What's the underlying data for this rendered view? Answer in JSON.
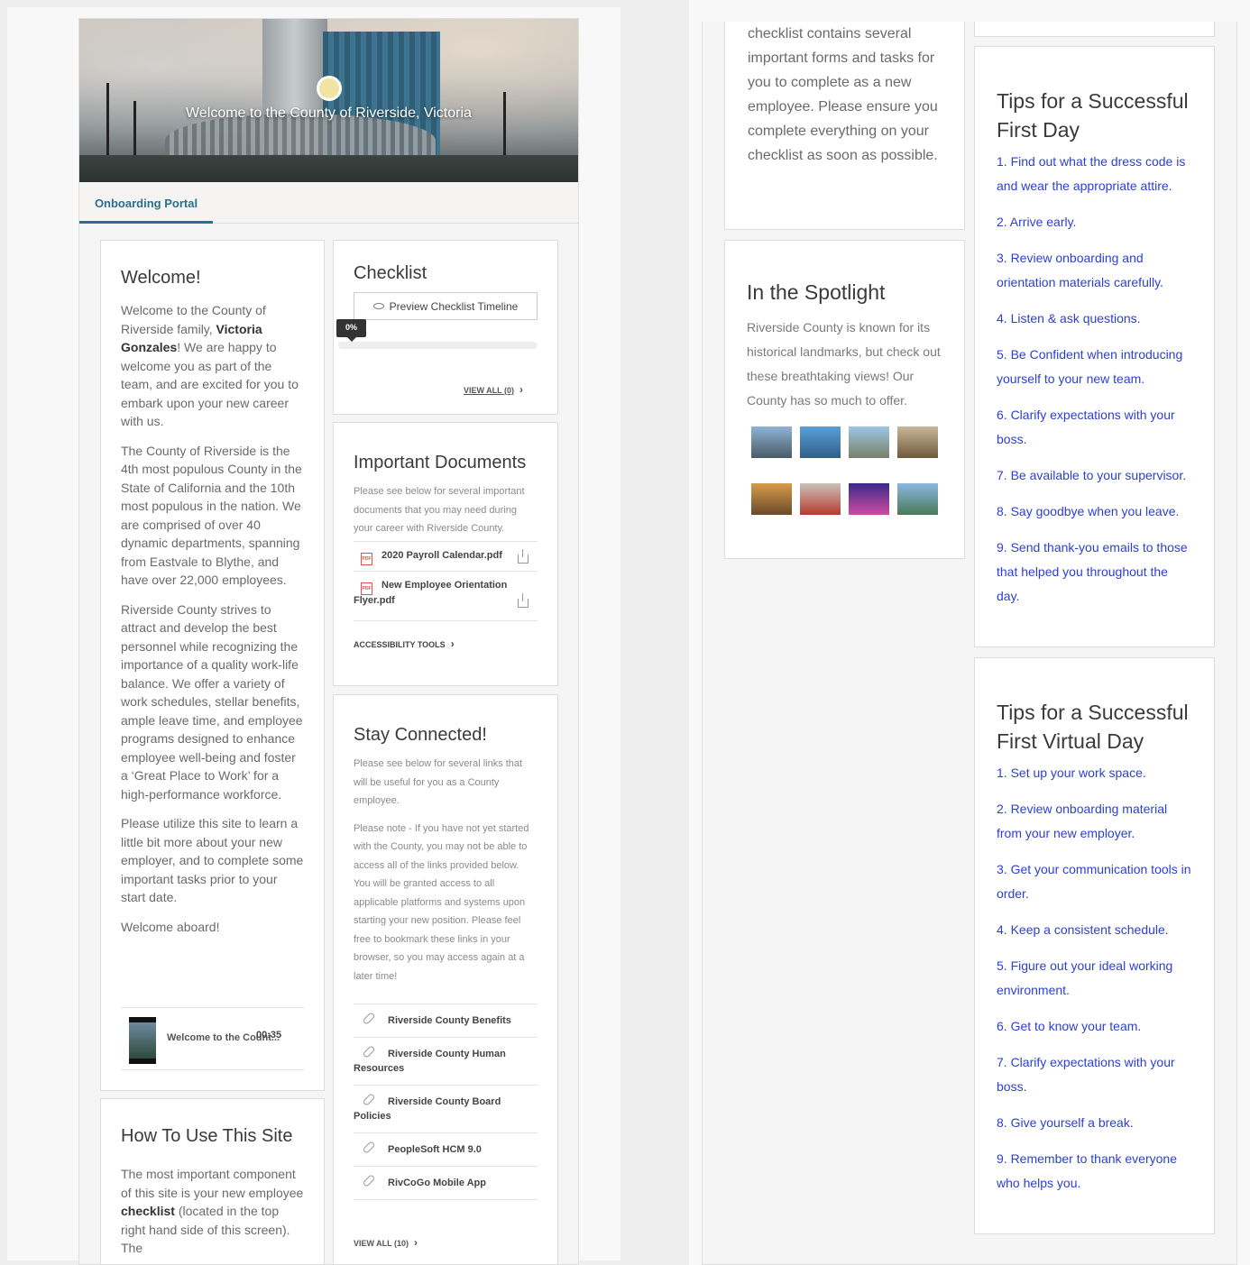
{
  "hero": {
    "title": "Welcome to the County of Riverside, Victoria"
  },
  "tabs": [
    {
      "label": "Onboarding Portal"
    }
  ],
  "welcome": {
    "heading": "Welcome!",
    "p1_a": "Welcome to the County of Riverside family, ",
    "p1_name": "Victoria Gonzales",
    "p1_b": "! We are happy to welcome you as part of the team, and are excited for you to embark upon your new career with us.",
    "p2": "The County of Riverside is the 4th most populous County in the State of California and the 10th most populous in the nation. We are comprised of over 40 dynamic departments, spanning from Eastvale to Blythe, and have over 22,000 employees.",
    "p3": "Riverside County strives to attract and develop the best personnel while recognizing the importance of a quality work-life balance. We offer a variety of work schedules, stellar benefits, ample leave time, and employee programs designed to enhance employee well-being and foster a ‘Great Place to Work’ for a high-performance workforce.",
    "p4": "Please utilize this site to learn a little bit more about your new employer, and to complete some important tasks prior to your start date.",
    "p5": "Welcome aboard!",
    "video": {
      "title": "Welcome to the Count...",
      "duration": "00:35"
    }
  },
  "howto": {
    "heading": "How To Use This Site",
    "text_a": "The most important component of this site is your new employee ",
    "text_bold": "checklist",
    "text_b": " (located in the top right hand side of this screen). The",
    "continued": "checklist contains several important forms and tasks for you to complete as a new employee. Please ensure you complete everything on your checklist as soon as possible."
  },
  "checklist": {
    "heading": "Checklist",
    "preview_label": "Preview Checklist Timeline",
    "progress_label": "0%",
    "progress_value": 0,
    "view_all": "VIEW ALL (0)"
  },
  "documents": {
    "heading": "Important Documents",
    "intro": "Please see below for several important documents that you may need during your career with Riverside County.",
    "items": [
      {
        "name": "2020 Payroll Calendar.pdf"
      },
      {
        "name": "New Employee Orientation Flyer.pdf"
      }
    ],
    "footer_link": "ACCESSIBILITY TOOLS"
  },
  "connected": {
    "heading": "Stay Connected!",
    "intro": "Please see below for several links that will be useful for you as a County employee.",
    "note": "Please note - If you have not yet started with the County, you may not be able to access all of the links provided below. You will be granted access to all applicable platforms and systems upon starting your new position. Please feel free to bookmark these links in your browser, so you may access again at a later time!",
    "links": [
      {
        "label": "Riverside County Benefits"
      },
      {
        "label": "Riverside County Human Resources"
      },
      {
        "label": "Riverside County Board Policies"
      },
      {
        "label": "PeopleSoft HCM 9.0"
      },
      {
        "label": "RivCoGo Mobile App"
      }
    ],
    "view_all": "VIEW ALL (10)"
  },
  "spotlight": {
    "heading": "In the Spotlight",
    "text": "Riverside County is known for its historical landmarks, but check out these breathtaking views! Our County has so much to offer."
  },
  "tips_first_day": {
    "heading": "Tips for a Successful First Day",
    "items": [
      "1. Find out what the dress code is and wear the appropriate attire.",
      "2. Arrive early.",
      "3. Review onboarding and orientation materials carefully.",
      "4. Listen & ask questions.",
      "5. Be Confident when introducing yourself to your new team.",
      "6. Clarify expectations with your boss.",
      "7. Be available to your supervisor.",
      "8. Say goodbye when you leave.",
      "9. Send thank-you emails to those that helped you throughout the day."
    ]
  },
  "tips_virtual": {
    "heading": "Tips for a Successful First Virtual Day",
    "items": [
      "1.  Set up your work space.",
      "2. Review onboarding material from your new employer.",
      "3. Get your communication tools in order.",
      "4. Keep a consistent schedule.",
      "5. Figure out your ideal working environment.",
      "6. Get to know your team.",
      "7. Clarify expectations with your boss.",
      "8. Give yourself a break.",
      "9. Remember to thank everyone who helps you."
    ]
  }
}
